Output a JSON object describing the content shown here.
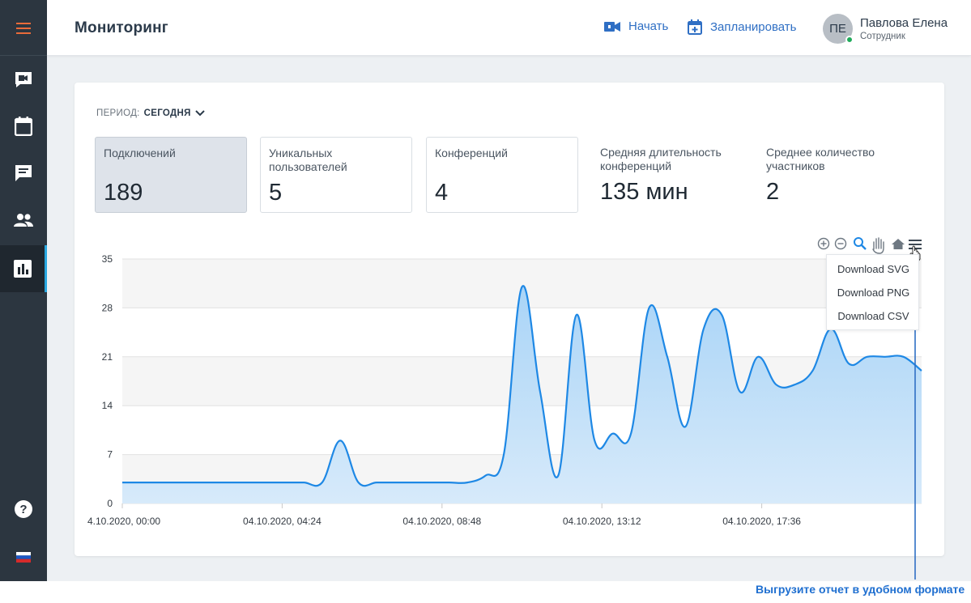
{
  "header": {
    "title": "Мониторинг",
    "start_label": "Начать",
    "schedule_label": "Запланировать",
    "user": {
      "initials": "ПЕ",
      "name": "Павлова Елена",
      "role": "Сотрудник"
    }
  },
  "sidebar": {
    "items": [
      {
        "icon": "menu-icon"
      },
      {
        "icon": "video-icon"
      },
      {
        "icon": "calendar-icon"
      },
      {
        "icon": "chat-icon"
      },
      {
        "icon": "users-icon"
      },
      {
        "icon": "chart-icon",
        "active": true
      },
      {
        "icon": "help-icon"
      },
      {
        "icon": "flag-ru-icon"
      }
    ]
  },
  "period": {
    "label": "ПЕРИОД:",
    "value": "СЕГОДНЯ"
  },
  "stats": [
    {
      "label": "Подключений",
      "value": "189"
    },
    {
      "label": "Уникальных пользователей",
      "value": "5"
    },
    {
      "label": "Конференций",
      "value": "4"
    },
    {
      "label": "Средняя длительность конференций",
      "value": "135 мин"
    },
    {
      "label": "Среднее количество участников",
      "value": "2"
    }
  ],
  "export_menu": [
    "Download SVG",
    "Download PNG",
    "Download CSV"
  ],
  "annotation": "Выгрузите отчет в удобном формате",
  "colors": {
    "accent": "#1e88e5",
    "area_top": "#a9d4f7",
    "area_bottom": "#d7eafa",
    "link": "#2f6fc4"
  },
  "chart_data": {
    "type": "area",
    "ylim": [
      0,
      35
    ],
    "yticks": [
      "0",
      "7",
      "14",
      "21",
      "28",
      "35"
    ],
    "xticks": [
      "04.10.2020, 00:00",
      "04.10.2020, 04:24",
      "04.10.2020, 08:48",
      "04.10.2020, 13:12",
      "04.10.2020, 17:36"
    ],
    "x_minutes_range": [
      0,
      1320
    ],
    "points": [
      [
        0,
        3
      ],
      [
        30,
        3
      ],
      [
        60,
        3
      ],
      [
        90,
        3
      ],
      [
        120,
        3
      ],
      [
        150,
        3
      ],
      [
        180,
        3
      ],
      [
        210,
        3
      ],
      [
        240,
        3
      ],
      [
        270,
        3
      ],
      [
        300,
        3
      ],
      [
        330,
        3
      ],
      [
        360,
        9
      ],
      [
        390,
        3
      ],
      [
        420,
        3
      ],
      [
        450,
        3
      ],
      [
        480,
        3
      ],
      [
        510,
        3
      ],
      [
        540,
        3
      ],
      [
        570,
        3
      ],
      [
        600,
        4
      ],
      [
        630,
        7
      ],
      [
        660,
        31
      ],
      [
        690,
        16
      ],
      [
        720,
        4
      ],
      [
        750,
        27
      ],
      [
        780,
        9
      ],
      [
        810,
        10
      ],
      [
        840,
        10
      ],
      [
        870,
        28
      ],
      [
        900,
        21
      ],
      [
        930,
        11
      ],
      [
        960,
        25
      ],
      [
        990,
        27
      ],
      [
        1020,
        16
      ],
      [
        1050,
        21
      ],
      [
        1080,
        17
      ],
      [
        1110,
        17
      ],
      [
        1140,
        19
      ],
      [
        1170,
        25
      ],
      [
        1200,
        20
      ],
      [
        1230,
        21
      ],
      [
        1260,
        21
      ],
      [
        1290,
        21
      ],
      [
        1320,
        19
      ]
    ]
  }
}
